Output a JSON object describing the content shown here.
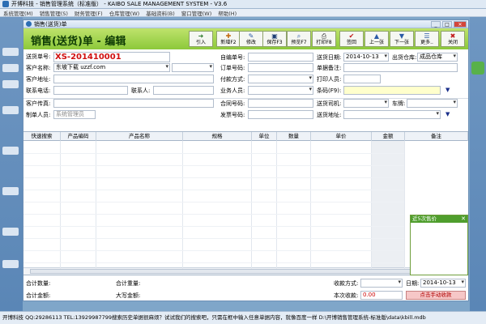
{
  "app": {
    "title": "开博科技 - 销售管理系统（标准版） - KAIBO SALE MANAGEMENT SYSTEM - V3.6"
  },
  "menu": [
    "系统管理(M)",
    "销售管理(S)",
    "财务管理(F)",
    "仓库管理(W)",
    "基础资料(B)",
    "窗口管理(W)",
    "帮助(H)"
  ],
  "window": {
    "title": "销售(送货)单",
    "minimize": "_",
    "maximize": "□",
    "close": "✕"
  },
  "bill": {
    "heading": "销售(送货)单 - 编辑"
  },
  "toolbar": [
    {
      "id": "import",
      "icon": "arrow-right-icon",
      "glyph": "➜",
      "label": "引入",
      "color": "#2d7a2d"
    },
    {
      "id": "new",
      "icon": "new-document-icon",
      "glyph": "✚",
      "label": "新增F2",
      "color": "#c36a12"
    },
    {
      "id": "edit",
      "icon": "edit-icon",
      "glyph": "✎",
      "label": "修改",
      "color": "#2b5aa6"
    },
    {
      "id": "save",
      "icon": "save-icon",
      "glyph": "▣",
      "label": "保存F3",
      "color": "#1e3f75"
    },
    {
      "id": "preview",
      "icon": "preview-icon",
      "glyph": "⌕",
      "label": "预览F7",
      "color": "#2b5aa6"
    },
    {
      "id": "print",
      "icon": "printer-icon",
      "glyph": "⎙",
      "label": "打印F8",
      "color": "#333333"
    },
    {
      "id": "approve",
      "icon": "checkmark-icon",
      "glyph": "✔",
      "label": "签回",
      "color": "#c01818"
    },
    {
      "id": "prev",
      "icon": "arrow-up-icon",
      "glyph": "▲",
      "label": "上一张",
      "color": "#2b5aa6"
    },
    {
      "id": "next",
      "icon": "arrow-down-icon",
      "glyph": "▼",
      "label": "下一张",
      "color": "#2b5aa6"
    },
    {
      "id": "more",
      "icon": "more-icon",
      "glyph": "☰",
      "label": "更多..",
      "color": "#2b5aa6"
    },
    {
      "id": "close",
      "icon": "close-icon",
      "glyph": "✖",
      "label": "关闭",
      "color": "#c01818"
    }
  ],
  "form": {
    "bill_no_label": "送货单号:",
    "bill_no": "XS-201410001",
    "self_no_label": "自编单号:",
    "self_no": "",
    "date_label": "送货日期:",
    "date": "2014-10-13",
    "warehouse_label": "出货仓库:",
    "warehouse": "成品仓库",
    "customer_label": "客户名称:",
    "customer": "东坡下载 uzzf.com",
    "order_no_label": "订单号码:",
    "order_no": "",
    "remark_label": "单据备注:",
    "remark": "",
    "address_label": "客户地址:",
    "address": "",
    "pay_method_label": "付款方式:",
    "pay_method": "",
    "printer_label": "打印人员:",
    "printer": "",
    "phone_label": "联系电话:",
    "phone": "",
    "contact_label": "联系人:",
    "contact": "",
    "sales_label": "业务人员:",
    "sales": "",
    "barcode_label": "条码(F9):",
    "barcode": "",
    "fax_label": "客户传真:",
    "fax": "",
    "contract_label": "合同号码:",
    "contract": "",
    "driver_label": "送货司机:",
    "driver": "",
    "plate_label": "车牌:",
    "plate": "",
    "maker_label": "制单人员:",
    "maker": "系统管理员",
    "invoice_label": "发票号码:",
    "invoice": "",
    "ship_addr_label": "送货地址:",
    "ship_addr": ""
  },
  "grid": {
    "columns": [
      "快速搜索",
      "产品编码",
      "产品名称",
      "规格",
      "单位",
      "数量",
      "单价",
      "金额",
      "备注"
    ]
  },
  "popup": {
    "title": "近5次售价",
    "close": "✕"
  },
  "footer": {
    "total_qty_label": "合计数量:",
    "total_qty": "",
    "total_weight_label": "合计重量:",
    "total_weight": "",
    "total_amount_label": "合计金额:",
    "total_amount": "",
    "upper_amount_label": "大写金额:",
    "upper_amount": "",
    "pay_method_label": "收款方式:",
    "pay_method": "",
    "pay_date_label": "日期:",
    "pay_date": "2014-10-13",
    "received_label": "本次收款:",
    "received": "0.00",
    "manual_pay_button": "点击手动收款"
  },
  "status_bar": "开博科技 QQ:29286113 TEL:13929987799搜索历史单据很麻烦？试试我们的搜索吧，只需在框中输入任意单据内容，就像百度一样 D:\\开博销售管理系统-标准版\\data\\kbill.mdb"
}
